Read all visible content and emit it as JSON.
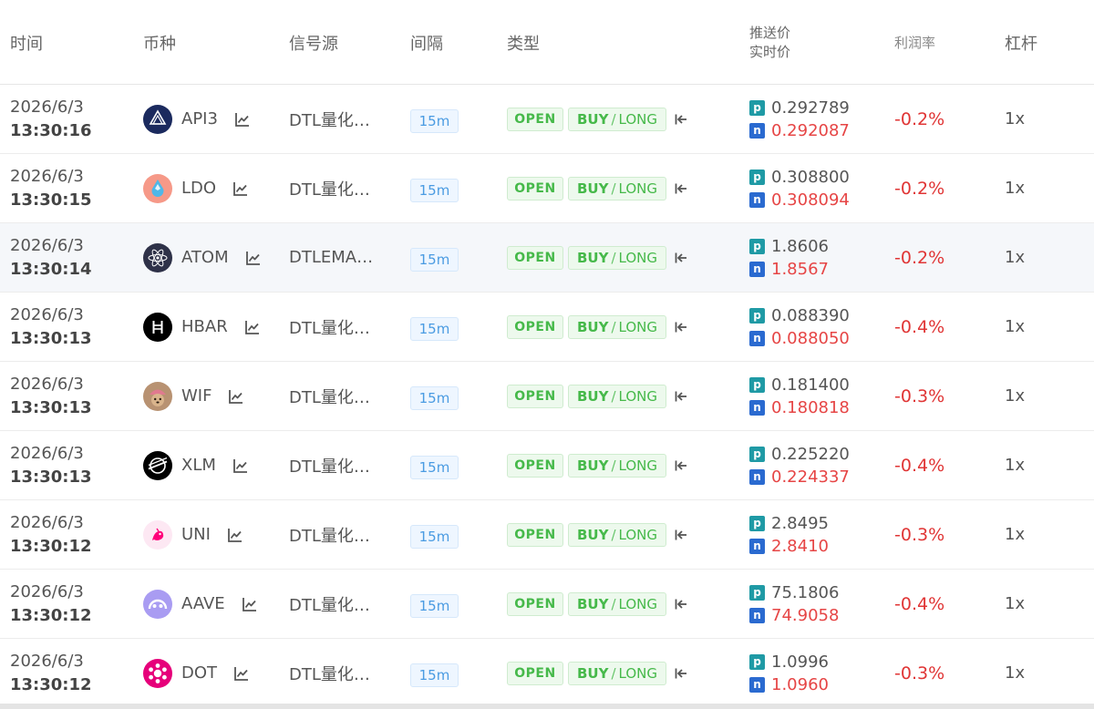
{
  "headers": {
    "time": "时间",
    "coin": "币种",
    "source": "信号源",
    "interval": "间隔",
    "type": "类型",
    "push_price": "推送价",
    "realtime_price": "实时价",
    "profit": "利润率",
    "leverage": "杠杆"
  },
  "labels": {
    "p": "p",
    "n": "n",
    "sep": "/"
  },
  "rows": [
    {
      "date": "2026/6/3",
      "time": "13:30:16",
      "coin": "API3",
      "coin_icon": "api3-logo-icon",
      "source": "DTL量化…",
      "interval": "15m",
      "open": "OPEN",
      "side": "BUY",
      "direction": "LONG",
      "push_price": "0.292789",
      "realtime_price": "0.292087",
      "profit": "-0.2%",
      "leverage": "1x"
    },
    {
      "date": "2026/6/3",
      "time": "13:30:15",
      "coin": "LDO",
      "coin_icon": "ldo-logo-icon",
      "source": "DTL量化…",
      "interval": "15m",
      "open": "OPEN",
      "side": "BUY",
      "direction": "LONG",
      "push_price": "0.308800",
      "realtime_price": "0.308094",
      "profit": "-0.2%",
      "leverage": "1x"
    },
    {
      "date": "2026/6/3",
      "time": "13:30:14",
      "coin": "ATOM",
      "coin_icon": "atom-logo-icon",
      "source": "DTLEMA…",
      "interval": "15m",
      "open": "OPEN",
      "side": "BUY",
      "direction": "LONG",
      "push_price": "1.8606",
      "realtime_price": "1.8567",
      "profit": "-0.2%",
      "leverage": "1x"
    },
    {
      "date": "2026/6/3",
      "time": "13:30:13",
      "coin": "HBAR",
      "coin_icon": "hbar-logo-icon",
      "source": "DTL量化…",
      "interval": "15m",
      "open": "OPEN",
      "side": "BUY",
      "direction": "LONG",
      "push_price": "0.088390",
      "realtime_price": "0.088050",
      "profit": "-0.4%",
      "leverage": "1x"
    },
    {
      "date": "2026/6/3",
      "time": "13:30:13",
      "coin": "WIF",
      "coin_icon": "wif-logo-icon",
      "source": "DTL量化…",
      "interval": "15m",
      "open": "OPEN",
      "side": "BUY",
      "direction": "LONG",
      "push_price": "0.181400",
      "realtime_price": "0.180818",
      "profit": "-0.3%",
      "leverage": "1x"
    },
    {
      "date": "2026/6/3",
      "time": "13:30:13",
      "coin": "XLM",
      "coin_icon": "xlm-logo-icon",
      "source": "DTL量化…",
      "interval": "15m",
      "open": "OPEN",
      "side": "BUY",
      "direction": "LONG",
      "push_price": "0.225220",
      "realtime_price": "0.224337",
      "profit": "-0.4%",
      "leverage": "1x"
    },
    {
      "date": "2026/6/3",
      "time": "13:30:12",
      "coin": "UNI",
      "coin_icon": "uni-logo-icon",
      "source": "DTL量化…",
      "interval": "15m",
      "open": "OPEN",
      "side": "BUY",
      "direction": "LONG",
      "push_price": "2.8495",
      "realtime_price": "2.8410",
      "profit": "-0.3%",
      "leverage": "1x"
    },
    {
      "date": "2026/6/3",
      "time": "13:30:12",
      "coin": "AAVE",
      "coin_icon": "aave-logo-icon",
      "source": "DTL量化…",
      "interval": "15m",
      "open": "OPEN",
      "side": "BUY",
      "direction": "LONG",
      "push_price": "75.1806",
      "realtime_price": "74.9058",
      "profit": "-0.4%",
      "leverage": "1x"
    },
    {
      "date": "2026/6/3",
      "time": "13:30:12",
      "coin": "DOT",
      "coin_icon": "dot-logo-icon",
      "source": "DTL量化…",
      "interval": "15m",
      "open": "OPEN",
      "side": "BUY",
      "direction": "LONG",
      "push_price": "1.0996",
      "realtime_price": "1.0960",
      "profit": "-0.3%",
      "leverage": "1x"
    }
  ],
  "colors": {
    "open_green": "#46b94a",
    "profit_red": "#e03535",
    "interval_blue": "#4a9be2",
    "p_badge": "#1f9aa5",
    "n_badge": "#2a6ad0"
  }
}
